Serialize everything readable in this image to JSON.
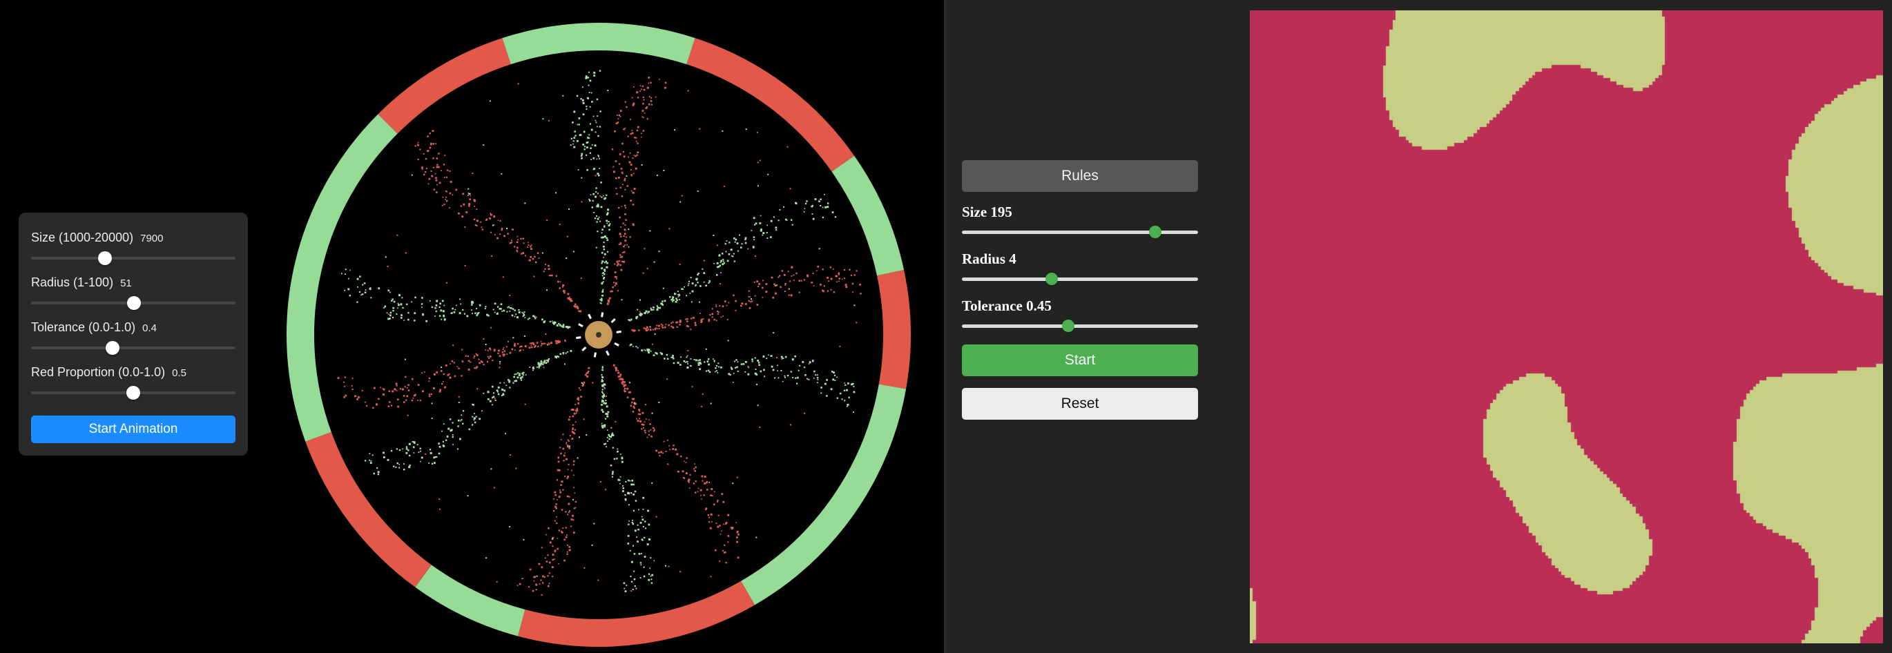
{
  "left_panel": {
    "sliders": [
      {
        "label": "Size (1000-20000)",
        "value": "7900",
        "fraction": 0.363
      },
      {
        "label": "Radius (1-100)",
        "value": "51",
        "fraction": 0.505
      },
      {
        "label": "Tolerance (0.0-1.0)",
        "value": "0.4",
        "fraction": 0.4
      },
      {
        "label": "Red Proportion (0.0-1.0)",
        "value": "0.5",
        "fraction": 0.5
      }
    ],
    "start_label": "Start Animation",
    "button_color": "#1a8cff"
  },
  "visualization": {
    "ring_red": "#e2594a",
    "ring_green": "#96dc96",
    "dot_red": "#e06055",
    "dot_green": "#a8e6a8",
    "center_color": "#c89a5a"
  },
  "right_panel": {
    "rules_label": "Rules",
    "sliders": [
      {
        "label": "Size 195",
        "fraction": 0.82
      },
      {
        "label": "Radius 4",
        "fraction": 0.38
      },
      {
        "label": "Tolerance 0.45",
        "fraction": 0.45
      }
    ],
    "start_label": "Start",
    "reset_label": "Reset",
    "start_color": "#4caf50"
  },
  "grid": {
    "red": "#bb2f56",
    "yellow": "#c7cf85"
  }
}
